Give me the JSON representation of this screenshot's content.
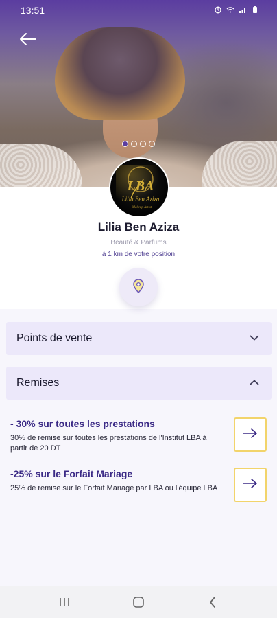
{
  "status_bar": {
    "time": "13:51",
    "icons": [
      "alarm-icon",
      "wifi-icon",
      "signal-icon",
      "battery-icon"
    ]
  },
  "hero": {
    "carousel_count": 4,
    "carousel_active": 0
  },
  "profile": {
    "name": "Lilia Ben Aziza",
    "category": "Beauté & Parfums",
    "distance": "à 1 km de votre position",
    "logo_text": "LBA"
  },
  "sections": {
    "points_de_vente": {
      "label": "Points de vente",
      "expanded": false
    },
    "remises": {
      "label": "Remises",
      "expanded": true
    }
  },
  "offers": [
    {
      "title": "- 30% sur toutes les prestations",
      "description": "30% de remise sur toutes les prestations de l'Institut LBA à partir de 20 DT"
    },
    {
      "title": "-25% sur le Forfait Mariage",
      "description": "25% de remise sur le Forfait Mariage par LBA ou l'équipe LBA"
    }
  ],
  "colors": {
    "accent": "#5b3da0",
    "offer_title": "#3b2a86",
    "section_bg": "#ece8fa",
    "button_border": "#f2d46b"
  }
}
